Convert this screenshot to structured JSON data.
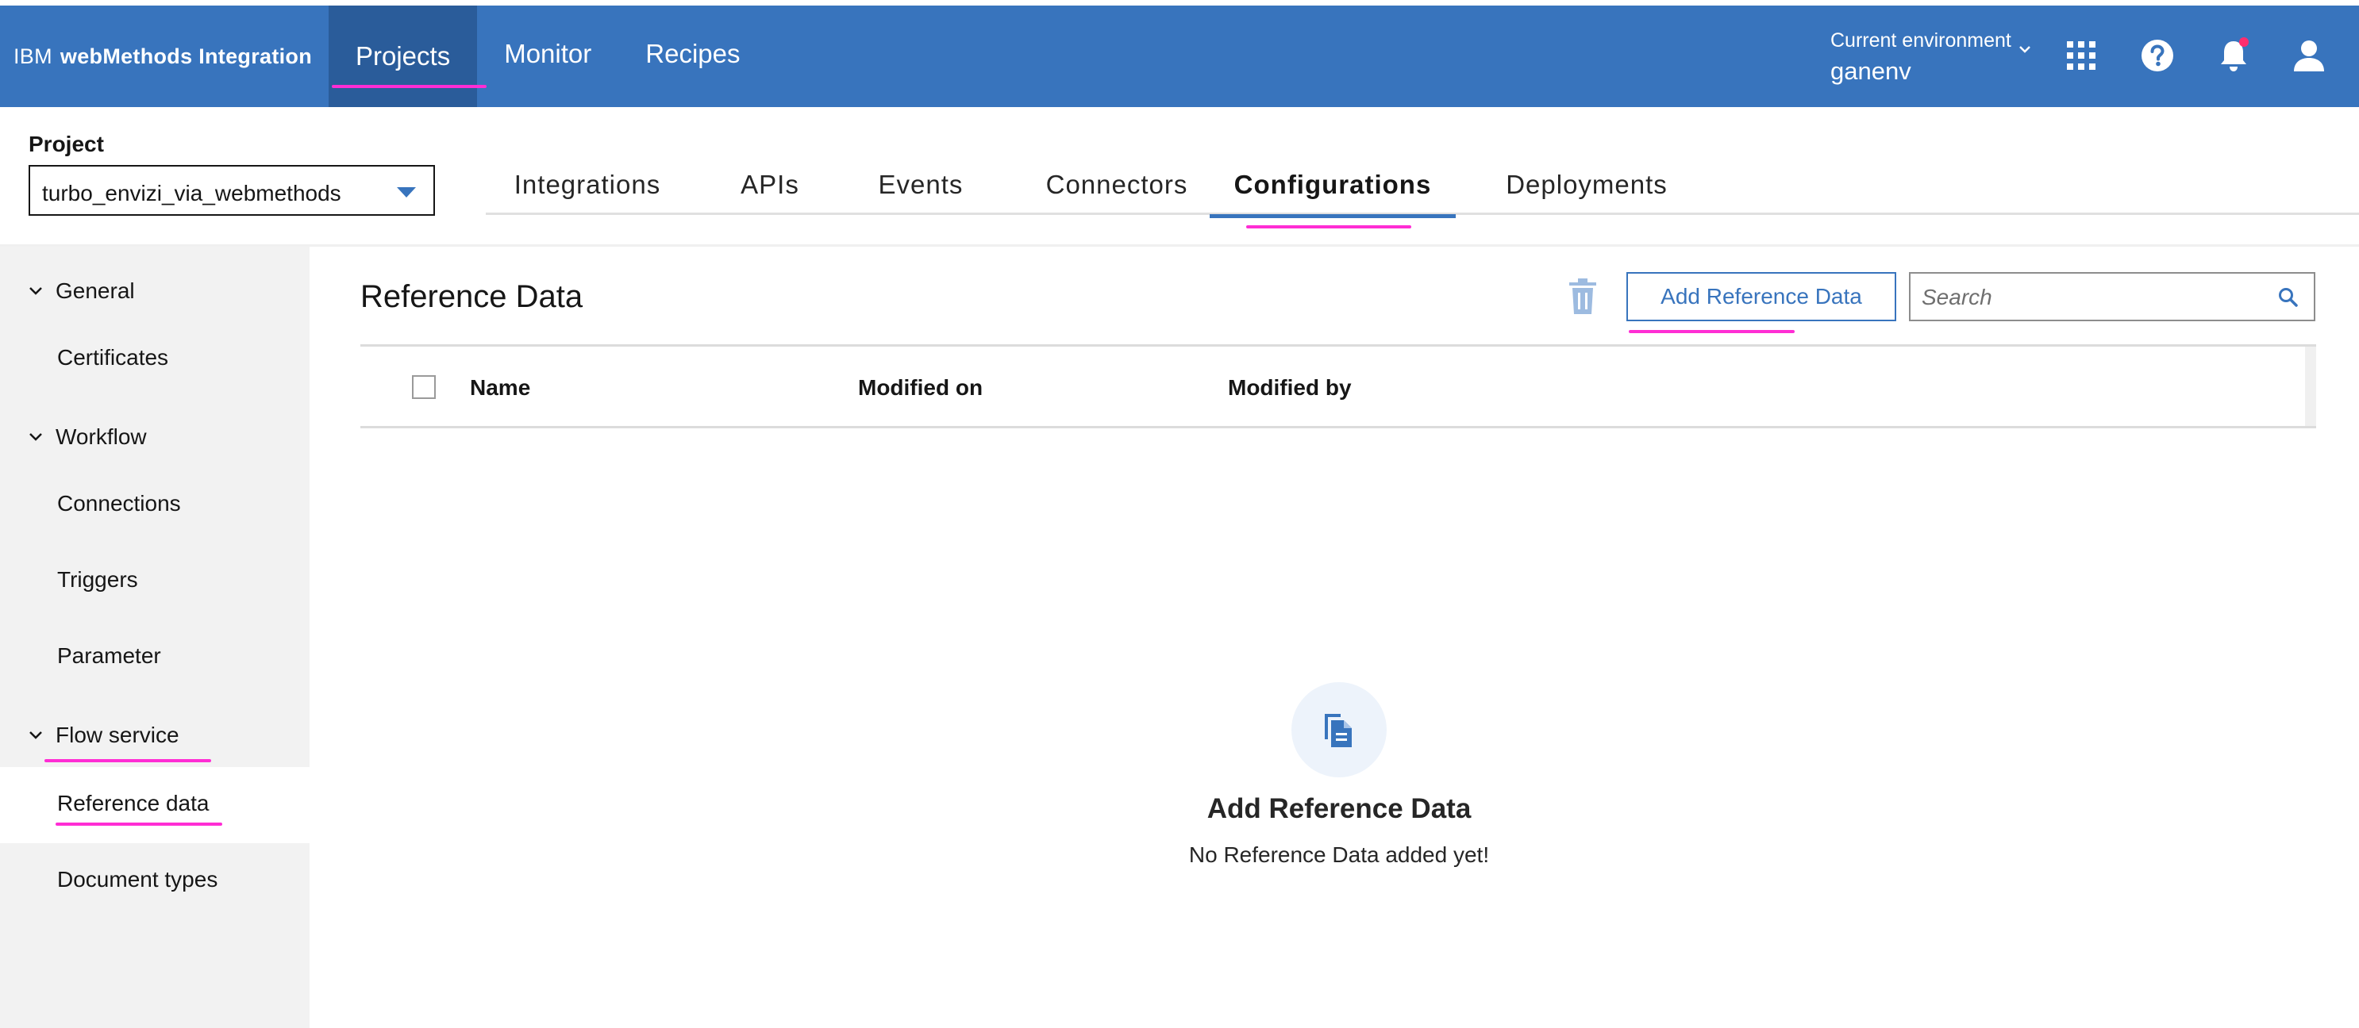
{
  "header": {
    "brand_prefix": "IBM",
    "brand_name": "webMethods Integration",
    "nav": [
      {
        "label": "Projects",
        "active": true
      },
      {
        "label": "Monitor",
        "active": false
      },
      {
        "label": "Recipes",
        "active": false
      }
    ],
    "environment": {
      "label": "Current environment",
      "value": "ganenv"
    },
    "icons": [
      "apps-grid-icon",
      "help-icon",
      "notification-bell-icon",
      "user-avatar-icon"
    ],
    "notification_dot_color": "#ff2d6e",
    "bar_color": "#3874bd"
  },
  "project": {
    "label": "Project",
    "selected": "turbo_envizi_via_webmethods"
  },
  "tabs": [
    {
      "label": "Integrations",
      "active": false
    },
    {
      "label": "APIs",
      "active": false
    },
    {
      "label": "Events",
      "active": false
    },
    {
      "label": "Connectors",
      "active": false
    },
    {
      "label": "Configurations",
      "active": true
    },
    {
      "label": "Deployments",
      "active": false
    }
  ],
  "sidebar": {
    "groups": [
      {
        "label": "General",
        "expanded": true,
        "items": [
          {
            "label": "Certificates"
          }
        ]
      },
      {
        "label": "Workflow",
        "expanded": true,
        "items": [
          {
            "label": "Connections"
          },
          {
            "label": "Triggers"
          },
          {
            "label": "Parameter"
          }
        ]
      },
      {
        "label": "Flow service",
        "expanded": true,
        "items": [
          {
            "label": "Reference data",
            "active": true
          },
          {
            "label": "Document types"
          }
        ]
      }
    ]
  },
  "main": {
    "title": "Reference Data",
    "add_button_label": "Add Reference Data",
    "search_placeholder": "Search",
    "table": {
      "columns": [
        "Name",
        "Modified on",
        "Modified by"
      ],
      "rows": []
    },
    "empty_state": {
      "icon": "document-copy-icon",
      "title": "Add Reference Data",
      "message": "No Reference Data added yet!"
    }
  },
  "annotation_color": "#ff2dd4"
}
